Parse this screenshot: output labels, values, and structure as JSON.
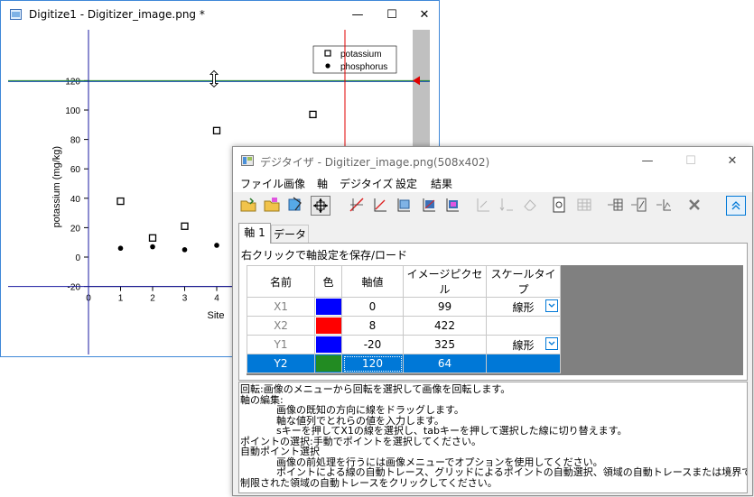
{
  "digitize_window": {
    "title": "Digitize1 - Digitizer_image.png *",
    "buttons": {
      "minimize": "—",
      "maximize": "☐",
      "close": "✕"
    },
    "plot": {
      "y_axis_label": "potassium (mg/kg)",
      "x_axis_label": "Site",
      "y_ticks": [
        "120",
        "100",
        "80",
        "60",
        "40",
        "20",
        "0",
        "-20"
      ],
      "x_ticks": [
        "0",
        "1",
        "2",
        "3",
        "4"
      ],
      "legend": [
        "potassium",
        "phosphorus"
      ]
    }
  },
  "chart_data": {
    "type": "scatter",
    "title": "",
    "xlabel": "Site",
    "ylabel": "potassium (mg/kg)",
    "xlim": [
      0,
      4
    ],
    "ylim": [
      -20,
      120
    ],
    "legend_position": "top-right",
    "series": [
      {
        "name": "potassium",
        "marker": "open-square",
        "x": [
          1,
          2,
          3,
          4,
          7
        ],
        "y": [
          38,
          13,
          21,
          86,
          97
        ]
      },
      {
        "name": "phosphorus",
        "marker": "filled-circle",
        "x": [
          1,
          2,
          3,
          4
        ],
        "y": [
          6,
          7,
          5,
          8
        ]
      }
    ]
  },
  "digitizer_window": {
    "title": "デジタイザ - Digitizer_image.png(508x402)",
    "buttons": {
      "minimize": "—",
      "maximize": "☐",
      "close": "✕"
    },
    "menu": [
      "ファイル",
      "画像",
      "軸",
      "デジタイズ",
      "設定",
      "結果"
    ],
    "tabs": [
      "軸 1",
      "データ"
    ],
    "panel_header": "右クリックで軸設定を保存/ロード",
    "table": {
      "columns": [
        "名前",
        "色",
        "軸値",
        "イメージピクセル",
        "スケールタイプ"
      ],
      "rows": [
        {
          "name": "X1",
          "color": "#0000ff",
          "value": "0",
          "pixel": "99",
          "scale": "線形"
        },
        {
          "name": "X2",
          "color": "#ff0000",
          "value": "8",
          "pixel": "422",
          "scale": ""
        },
        {
          "name": "Y1",
          "color": "#0000ff",
          "value": "-20",
          "pixel": "325",
          "scale": "線形"
        },
        {
          "name": "Y2",
          "color": "#228b22",
          "value": "120",
          "pixel": "64",
          "scale": ""
        }
      ]
    },
    "help_lines": [
      "回転:画像のメニューから回転を選択して画像を回転します。",
      "軸の編集:",
      "画像の既知の方向に線をドラッグします。",
      "軸な値列でとれらの値を入力します。",
      "sキーを押してX1の線を選択し、tabキーを押して選択した線に切り替えます。",
      "ポイントの選択:手動でポイントを選択してください。",
      "自動ポイント選択",
      "画像の前処理を行うには画像メニューでオプションを使用してください。",
      "ポイントによる線の自動トレース、グリッドによるポイントの自動選択、領域の自動トレースまたは境界で",
      "制限された領域の自動トレースをクリックしてください。"
    ]
  },
  "colors": {
    "accent": "#0078d7",
    "axis_blue": "#0000ff",
    "axis_red": "#ff0000",
    "axis_green": "#228b22"
  }
}
